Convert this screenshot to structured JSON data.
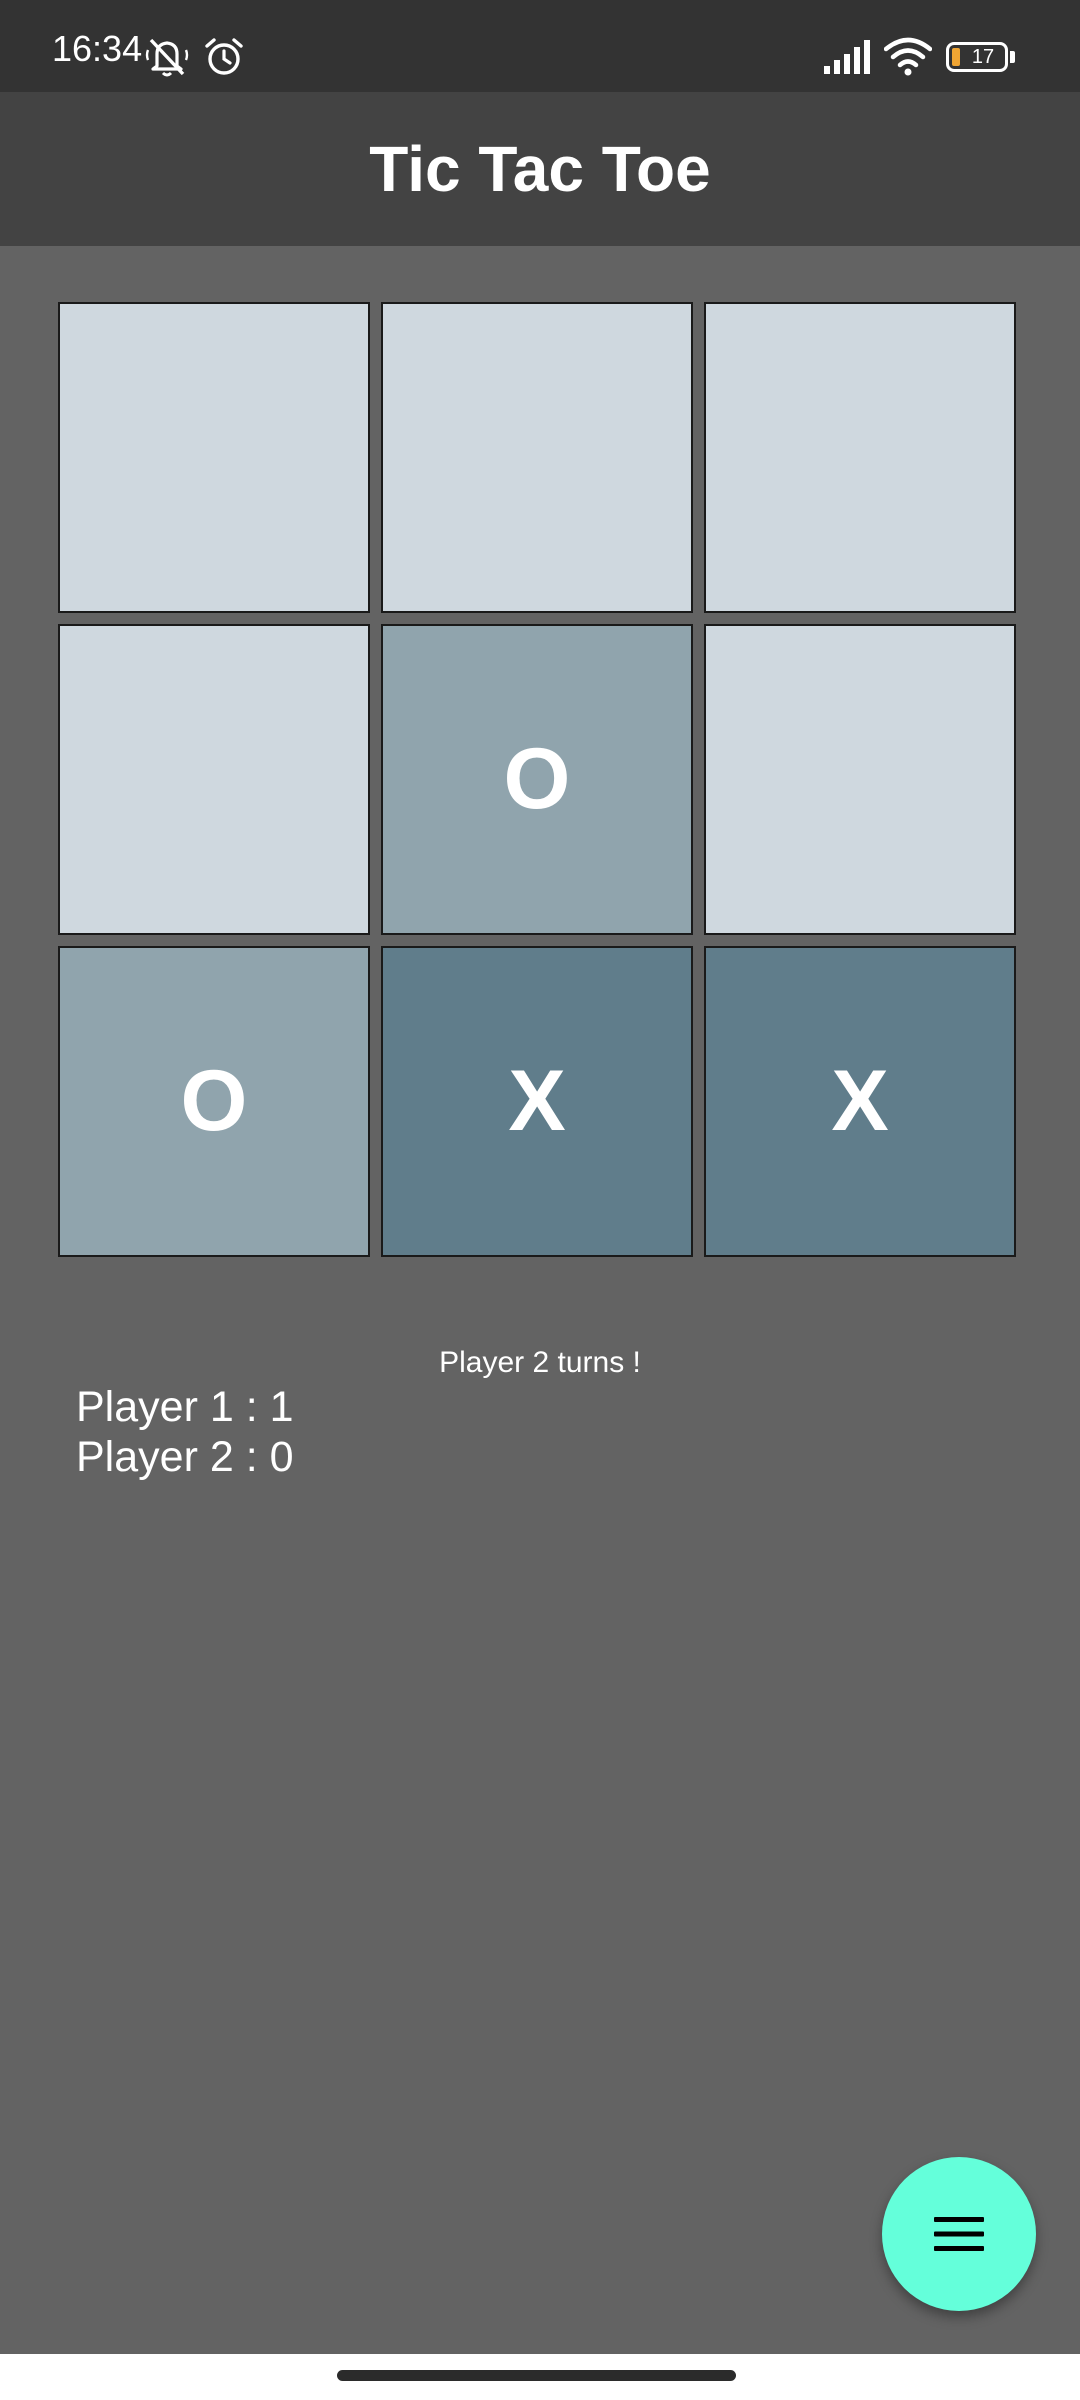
{
  "status_bar": {
    "time": "16:34",
    "battery_level": "17",
    "icons": [
      "mute-icon",
      "alarm-icon",
      "signal-icon",
      "wifi-icon",
      "battery-icon"
    ]
  },
  "app_bar": {
    "title": "Tic Tac Toe"
  },
  "board": {
    "cells": [
      {
        "mark": "",
        "color": "#cfd8df"
      },
      {
        "mark": "",
        "color": "#cfd8df"
      },
      {
        "mark": "",
        "color": "#cfd8df"
      },
      {
        "mark": "",
        "color": "#cfd8df"
      },
      {
        "mark": "O",
        "color": "#90a4ad"
      },
      {
        "mark": "",
        "color": "#cfd8df"
      },
      {
        "mark": "O",
        "color": "#90a4ad"
      },
      {
        "mark": "X",
        "color": "#607d8b"
      },
      {
        "mark": "X",
        "color": "#607d8b"
      }
    ]
  },
  "game": {
    "turn_text": "Player 2 turns !",
    "scores": [
      {
        "label": "Player 1 : 1"
      },
      {
        "label": "Player 2 : 0"
      }
    ]
  },
  "fab": {
    "icon": "menu-icon",
    "color": "#64ffda"
  }
}
